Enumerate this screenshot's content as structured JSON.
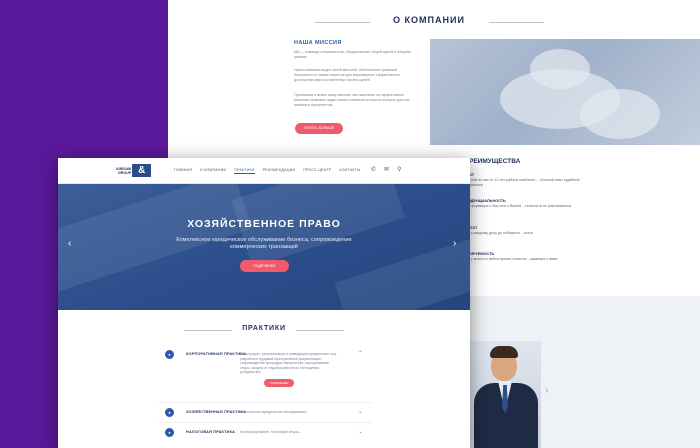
{
  "colors": {
    "background": "#5a189a",
    "brand": "#2d5aa8",
    "accent": "#ef5b6d",
    "text_dark": "#1f2f57"
  },
  "back_page": {
    "section_title": "О КОМПАНИИ",
    "mission_title": "НАША МИССИЯ",
    "paragraphs": [
      "Мы — команда специалистов, объединенных общей идеей и общими целями.",
      "Наша компания видит своей миссией: обеспечение правовой безопасности наших клиентов для максимально эффективного достижения ими поставленных бизнес-целей.",
      "Пригашаем в жизнь нашу миссию, мы нацелены на эффективное решение правовых задач наших клиентов интересы которых для нас являются приоритетом."
    ],
    "more_button": "ЧИТАТЬ БОЛЬШЕ",
    "advantages_title": "РЕИМУЩЕСТВА",
    "advantages": [
      {
        "title": "ЫТ",
        "text": "...ной из нас не 12 лет работы наиболее ... богатый опыт судебной практики"
      },
      {
        "title": "ИДЕНЦИАЛЬНОСТЬ",
        "text": "...формация о Вас или о Вашей ...тельности не разглашается"
      },
      {
        "title": "ЬТАТ",
        "text": "...к каждому делу до победного ...ьтата"
      },
      {
        "title": "ТИРУЕМОСТЬ",
        "text": "...у можно в любое время, клиенты ...ываемся с вами"
      }
    ],
    "team_arrow": "›"
  },
  "front_page": {
    "logo_text": [
      "IURISAM",
      "GROUP"
    ],
    "logo_mark": "&",
    "nav": [
      "ГЛАВНАЯ",
      "О КОМПАНИИ",
      "ПРАКТИКИ",
      "РЕКОМЕНДАЦИИ",
      "ПРЕСС-ЦЕНТР",
      "КОНТАКТЫ"
    ],
    "nav_active_index": 2,
    "nav_icons": [
      "phone-icon",
      "mail-icon",
      "search-icon"
    ],
    "hero": {
      "title": "ХОЗЯЙСТВЕННОЕ ПРАВО",
      "subtitle": "Комплексное юридическое обслуживание бизнеса, сопровождение коммерческих транзакций",
      "button": "ПОДРОБНЕЕ",
      "prev": "‹",
      "next": "›"
    },
    "practices_title": "ПРАКТИКИ",
    "practices": [
      {
        "name": "КОРПОРАТИВНАЯ ПРАКТИКА",
        "desc": "Регистрация, реорганизация и ликвидация юридических лиц, разработка трудовой корпоративной документации, сопровождение процедуры банкротства, корпоративные споры, защита от недобросовестного поглощения (рейдерство)",
        "button": "ПОДРОБНЕЕ",
        "chevron": "⌃"
      },
      {
        "name": "ХОЗЯЙСТВЕННАЯ ПРАКТИКА",
        "desc": "Комплексное юридическое обслуживание...",
        "chevron": "⌄"
      },
      {
        "name": "НАЛОГОВАЯ ПРАКТИКА",
        "desc": "Консультирование, налоговые споры...",
        "chevron": "⌄"
      }
    ]
  }
}
